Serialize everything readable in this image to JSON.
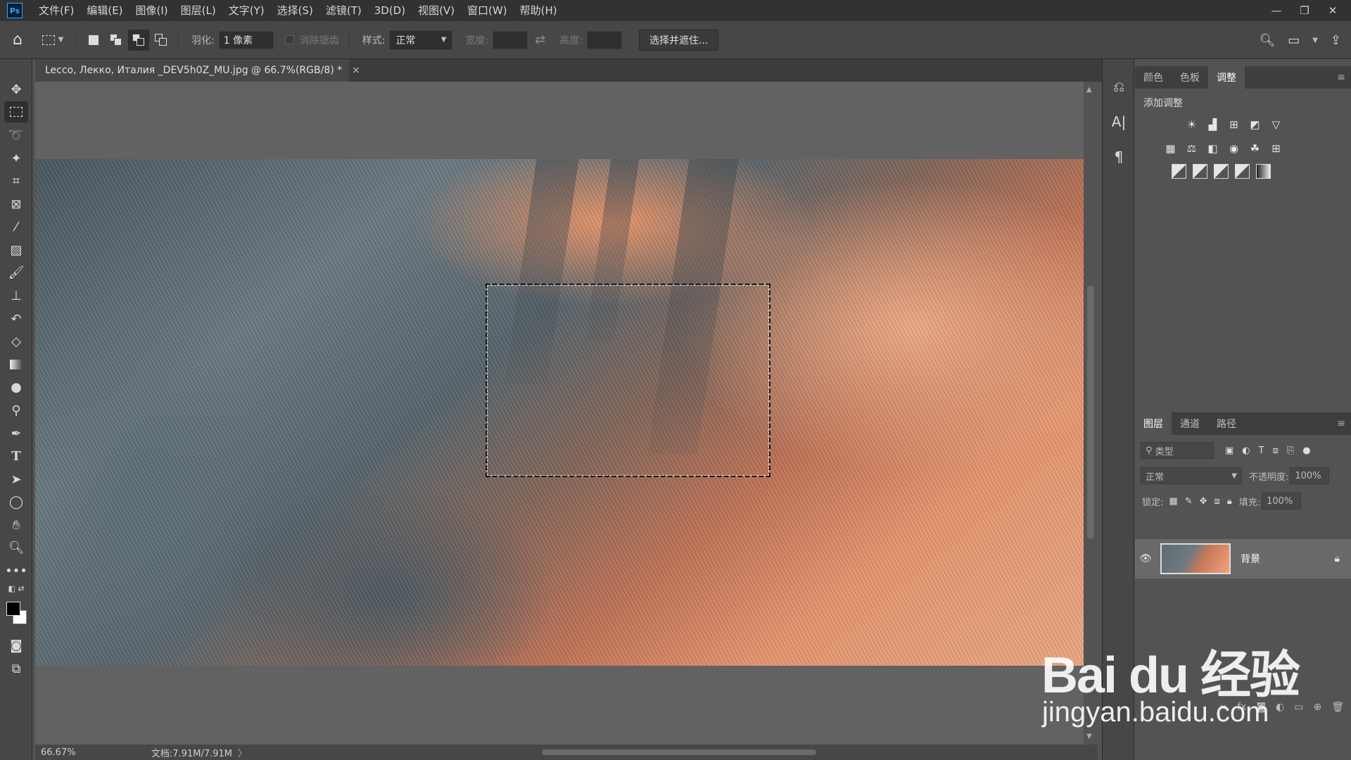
{
  "app": {
    "logo": "Ps"
  },
  "menu": [
    "文件(F)",
    "编辑(E)",
    "图像(I)",
    "图层(L)",
    "文字(Y)",
    "选择(S)",
    "滤镜(T)",
    "3D(D)",
    "视图(V)",
    "窗口(W)",
    "帮助(H)"
  ],
  "window_controls": {
    "minimize": "—",
    "restore": "❐",
    "close": "✕"
  },
  "options": {
    "feather_label": "羽化:",
    "feather_value": "1 像素",
    "antialias_label": "消除锯齿",
    "style_label": "样式:",
    "style_value": "正常",
    "width_label": "宽度:",
    "height_label": "高度:",
    "select_mask_button": "选择并遮住..."
  },
  "document_tab": {
    "title": "Lecco, Лекко, Италия _DEV5h0Z_MU.jpg @ 66.7%(RGB/8) *",
    "close": "×"
  },
  "status": {
    "zoom": "66.67%",
    "doc": "文档:7.91M/7.91M",
    "more": "〉"
  },
  "panels": {
    "top_tabs": [
      "颜色",
      "色板",
      "调整"
    ],
    "active_top_tab": "调整",
    "adjust_title": "添加调整",
    "layers_tabs": [
      "图层",
      "通道",
      "路径"
    ],
    "layer_filter": "类型",
    "blend_mode": "正常",
    "opacity_label": "不透明度:",
    "opacity_value": "100%",
    "lock_label": "锁定:",
    "fill_label": "填充:",
    "fill_value": "100%",
    "layer_name": "背景"
  },
  "watermark": {
    "main": "Bai du 经验",
    "sub": "jingyan.baidu.com"
  }
}
